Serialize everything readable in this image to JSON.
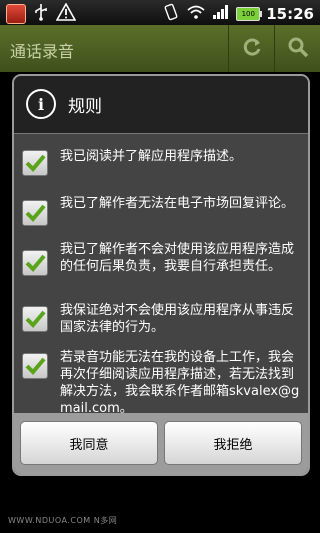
{
  "status_bar": {
    "time": "15:26",
    "battery_label": "100"
  },
  "app": {
    "title": "通话录音"
  },
  "dialog": {
    "title": "规则",
    "items": [
      {
        "text": "我已阅读并了解应用程序描述。",
        "checked": true
      },
      {
        "text": "我已了解作者无法在电子市场回复评论。",
        "checked": true
      },
      {
        "text": "我已了解作者不会对使用该应用程序造成的任何后果负责，我要自行承担责任。",
        "checked": true
      },
      {
        "text": "我保证绝对不会使用该应用程序从事违反国家法律的行为。",
        "checked": true
      },
      {
        "text": "若录音功能无法在我的设备上工作，我会再次仔细阅读应用程序描述，若无法找到解决方法，我会联系作者邮箱skvalex@gmail.com。",
        "checked": true
      }
    ],
    "agree_label": "我同意",
    "refuse_label": "我拒绝"
  },
  "watermark": "WWW.NDUOA.COM N多网",
  "colors": {
    "titlebar": "#4d6022",
    "check_green": "#5aa41c",
    "dialog_bg": "#444444"
  }
}
